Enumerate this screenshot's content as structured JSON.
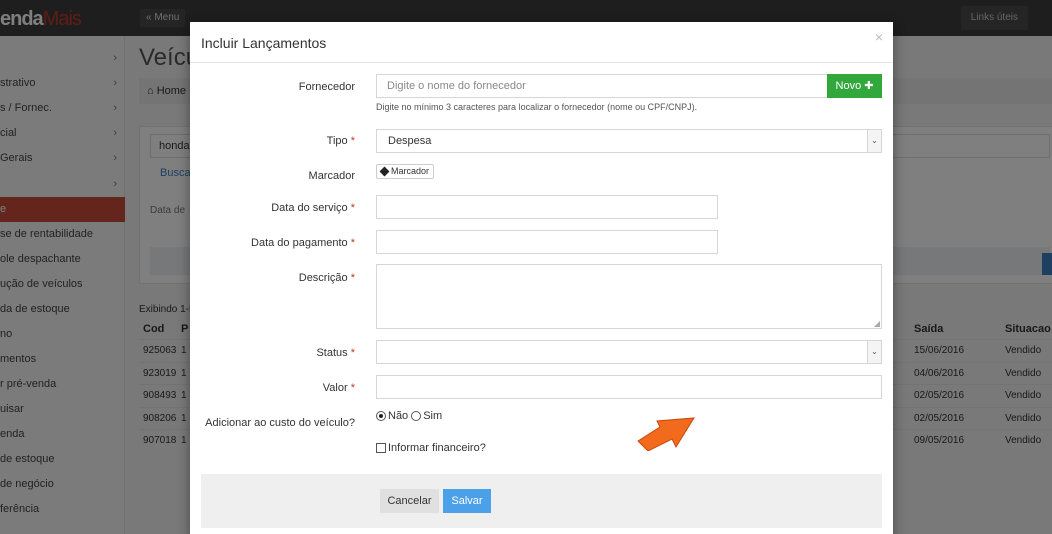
{
  "app": {
    "brand_main": "enda",
    "brand_accent": "Mais",
    "menu_label": "« Menu",
    "links_label": "Links úteis"
  },
  "sidebar": {
    "items": [
      {
        "label": "",
        "arrow": "›"
      },
      {
        "label": "strativo",
        "arrow": "›"
      },
      {
        "label": "s / Fornec.",
        "arrow": "›"
      },
      {
        "label": "cial",
        "arrow": "›"
      },
      {
        "label": "Gerais",
        "arrow": "›"
      },
      {
        "label": "",
        "arrow": "›"
      },
      {
        "label": "e",
        "arrow": ""
      },
      {
        "label": "se de rentabilidade",
        "arrow": ""
      },
      {
        "label": "ole despachante",
        "arrow": ""
      },
      {
        "label": "ução de veículos",
        "arrow": ""
      },
      {
        "label": "da de estoque",
        "arrow": ""
      },
      {
        "label": "no",
        "arrow": ""
      },
      {
        "label": "mentos",
        "arrow": ""
      },
      {
        "label": "r pré-venda",
        "arrow": ""
      },
      {
        "label": "uisar",
        "arrow": ""
      },
      {
        "label": "enda",
        "arrow": ""
      },
      {
        "label": "de estoque",
        "arrow": ""
      },
      {
        "label": "de negócio",
        "arrow": ""
      },
      {
        "label": "ferência",
        "arrow": ""
      }
    ]
  },
  "main": {
    "heading": "Veícu",
    "breadcrumb": "Home",
    "filter_value": "honda",
    "filter_link": "Busca",
    "filter_label": "Data de",
    "table_info": "Exibindo 1-5",
    "table": {
      "headers": {
        "cod": "Cod",
        "p": "P",
        "saida": "Saída",
        "situacao": "Situacao"
      },
      "rows": [
        {
          "cod": "925063",
          "p": "1",
          "saida": "15/06/2016",
          "situacao": "Vendido"
        },
        {
          "cod": "923019",
          "p": "1",
          "saida": "04/06/2016",
          "situacao": "Vendido"
        },
        {
          "cod": "908493",
          "p": "1",
          "saida": "02/05/2016",
          "situacao": "Vendido"
        },
        {
          "cod": "908206",
          "p": "1",
          "saida": "02/05/2016",
          "situacao": "Vendido"
        },
        {
          "cod": "907018",
          "p": "1",
          "saida": "09/05/2016",
          "situacao": "Vendido"
        }
      ]
    }
  },
  "modal": {
    "title": "Incluir Lançamentos",
    "close": "×",
    "fornecedor": {
      "label": "Fornecedor",
      "placeholder": "Digite o nome do fornecedor",
      "novo_label": "Novo ✚",
      "help": "Digite no mínimo 3 caracteres para localizar o fornecedor (nome ou CPF/CNPJ)."
    },
    "tipo": {
      "label": "Tipo",
      "value": "Despesa"
    },
    "marcador": {
      "label": "Marcador",
      "tag": "Marcador"
    },
    "data_servico": {
      "label": "Data do serviço",
      "value": ""
    },
    "data_pagamento": {
      "label": "Data do pagamento",
      "value": ""
    },
    "descricao": {
      "label": "Descrição",
      "value": ""
    },
    "status": {
      "label": "Status",
      "value": ""
    },
    "valor": {
      "label": "Valor",
      "value": ""
    },
    "custo": {
      "label": "Adicionar ao custo do veículo?",
      "opt_no": "Não",
      "opt_yes": "Sim",
      "selected": "Não"
    },
    "financeiro": {
      "label": "Informar financeiro?",
      "checked": false
    },
    "required_mark": "*",
    "cancel_label": "Cancelar",
    "save_label": "Salvar"
  },
  "colors": {
    "accent_red": "#c94a3a",
    "novo_green": "#32a83c",
    "save_blue": "#4ba0ea",
    "annotation_arrow": "#f26a1b"
  }
}
